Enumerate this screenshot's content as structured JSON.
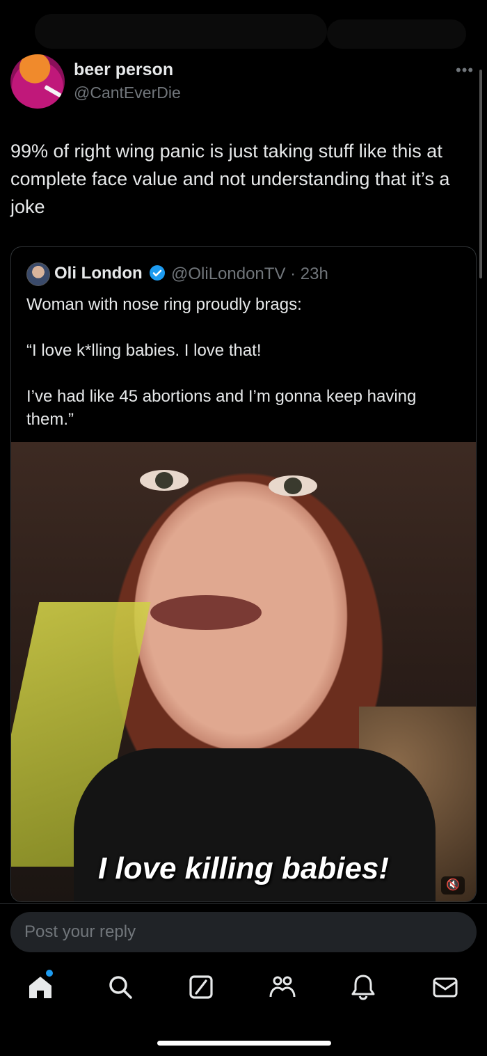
{
  "author": {
    "display_name": "beer person",
    "handle": "@CantEverDie",
    "more_icon": "more-icon"
  },
  "post": {
    "text": "99% of right wing panic is just taking stuff like this at complete face value and not understanding that it’s a joke"
  },
  "quoted": {
    "name": "Oli London",
    "handle_time": "@OliLondonTV · 23h",
    "verified_color": "#1d9bf0",
    "paragraphs": [
      "Woman with nose ring proudly brags:",
      "“I love k*lling babies. I love that!",
      "I’ve had like 45 abortions and I’m gonna keep having them.”"
    ],
    "video_caption": "I love killing babies!"
  },
  "reply": {
    "placeholder": "Post your reply"
  },
  "nav": {
    "items": [
      "home-icon",
      "search-icon",
      "grok-icon",
      "communities-icon",
      "notifications-icon",
      "messages-icon"
    ]
  }
}
